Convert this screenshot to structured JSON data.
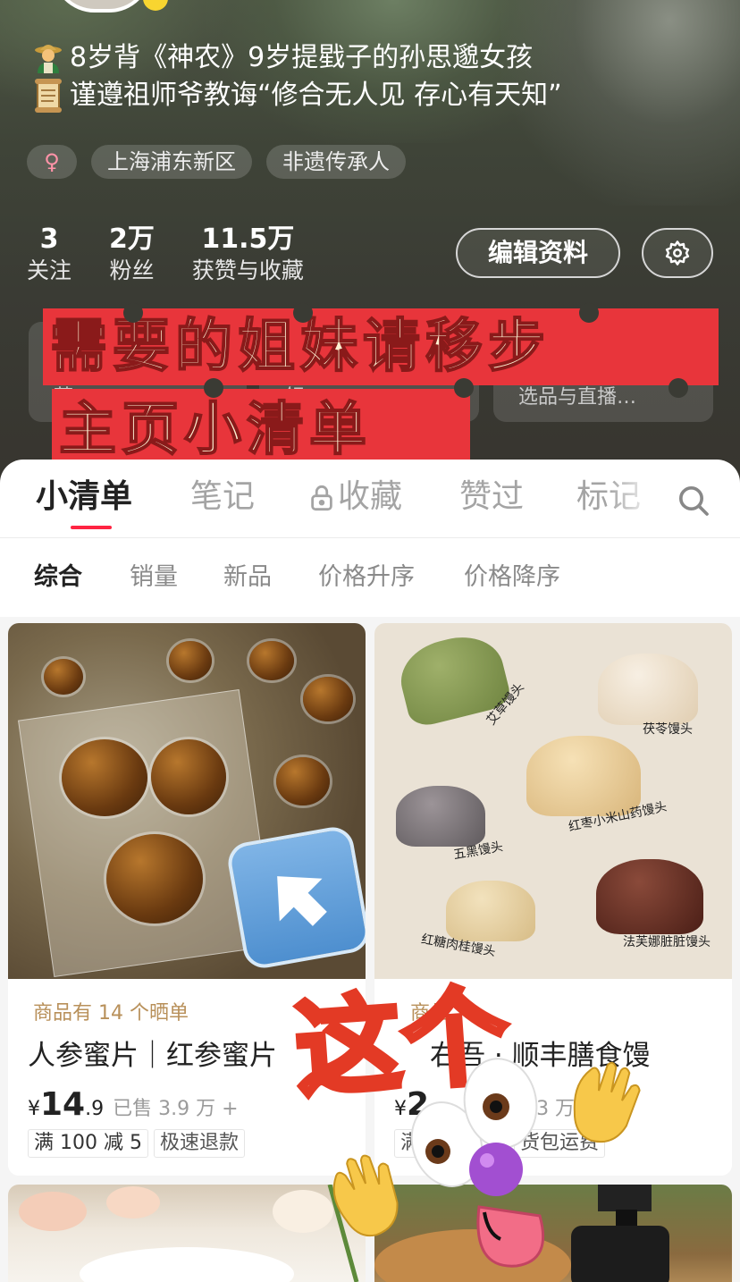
{
  "profile": {
    "bio_line1": "8岁背《神农》9岁提戥子的孙思邈女孩",
    "bio_line2": "谨遵祖师爷教诲“修合无人见 存心有天知”",
    "bio_icon1": "farmer-emoji",
    "bio_icon2": "scroll-emoji",
    "gender_symbol": "♀",
    "tags": [
      "上海浦东新区",
      "非遗传承人"
    ],
    "stats": [
      {
        "value": "3",
        "label": "关注"
      },
      {
        "value": "2万",
        "label": "粉丝"
      },
      {
        "value": "11.5万",
        "label": "获赞与收藏"
      }
    ],
    "edit_button": "编辑资料",
    "settings_icon": "gear-icon",
    "cards": [
      "荐",
      "领",
      "选品与直播…"
    ]
  },
  "banner": {
    "line1": "需要的姐妹请移步",
    "line2": "主页小清单"
  },
  "tabs": [
    {
      "label": "小清单",
      "active": true
    },
    {
      "label": "笔记",
      "active": false
    },
    {
      "label": "收藏",
      "active": false,
      "locked": true
    },
    {
      "label": "赞过",
      "active": false
    },
    {
      "label": "标记",
      "active": false
    }
  ],
  "sort_options": [
    "综合",
    "销量",
    "新品",
    "价格升序",
    "价格降序"
  ],
  "products": [
    {
      "meta": "商品有 14 个晒单",
      "title": "人参蜜片｜红参蜜片",
      "currency": "¥",
      "price_int": "14",
      "price_dec": ".9",
      "sold": "已售 3.9 万 +",
      "promos": [
        "满 100 减 5",
        "极速退款"
      ]
    },
    {
      "meta": "商品",
      "title": "右吾 · 顺丰膳食馒",
      "currency": "¥",
      "price_int": "2",
      "price_dec": "",
      "sold": "3 万",
      "promos": [
        "满",
        "5",
        "货包运费"
      ],
      "bun_labels": [
        "艾草馒头",
        "茯苓馒头",
        "红枣小米山药馒头",
        "五黑馒头",
        "红糖肉桂馒头",
        "法芙娜脏脏馒头"
      ]
    }
  ],
  "overlay": {
    "big_text": "这个",
    "arrow_icon": "up-arrow-emoji",
    "wave_icon": "waving-hand-emoji",
    "face_icon": "crazy-face-emoji"
  },
  "colors": {
    "accent": "#ff2442",
    "banner_red": "#e8353b",
    "banner_text": "#fff2d3",
    "meta_gold": "#b8905a"
  }
}
